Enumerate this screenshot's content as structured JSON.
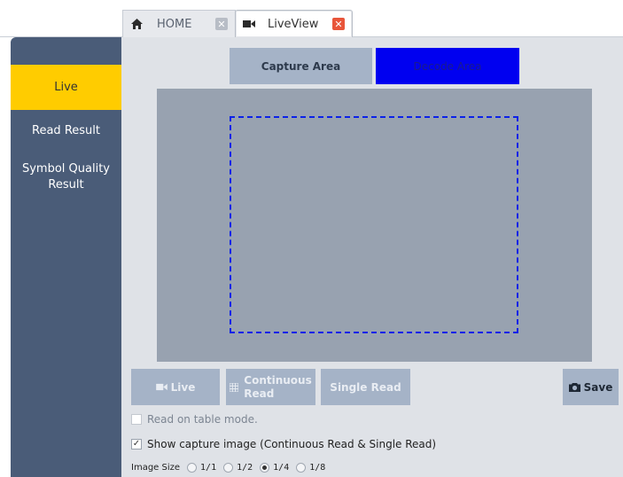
{
  "tabs": {
    "home": {
      "label": "HOME",
      "close": "✕"
    },
    "liveview": {
      "label": "LiveView",
      "close": "✕"
    }
  },
  "sidebar": {
    "live": "Live",
    "read_result": "Read Result",
    "symbol_quality": "Symbol Quality Result"
  },
  "area": {
    "capture": "Capture Area",
    "decode": "Decode Area"
  },
  "controls": {
    "live": "Live",
    "continuous_line1": "Continuous",
    "continuous_line2": "Read",
    "single_read": "Single Read",
    "save": "Save"
  },
  "options": {
    "read_on_table": "Read on table mode.",
    "read_on_table_checked": false,
    "show_capture": "Show capture image (Continuous Read & Single Read)",
    "show_capture_checked": true,
    "image_size_label": "Image Size",
    "image_sizes": [
      "1/1",
      "1/2",
      "1/4",
      "1/8"
    ],
    "image_size_selected": "1/4"
  },
  "colors": {
    "sidebar": "#4a5c78",
    "active_item": "#ffcc00",
    "decode_area": "#0000f0",
    "decode_rect": "#0b22e8"
  },
  "icons": {
    "home_tab": "home-icon",
    "liveview_tab": "video-camera-icon",
    "live_button": "video-camera-icon",
    "continuous_button": "grid-icon",
    "save_button": "camera-icon"
  }
}
